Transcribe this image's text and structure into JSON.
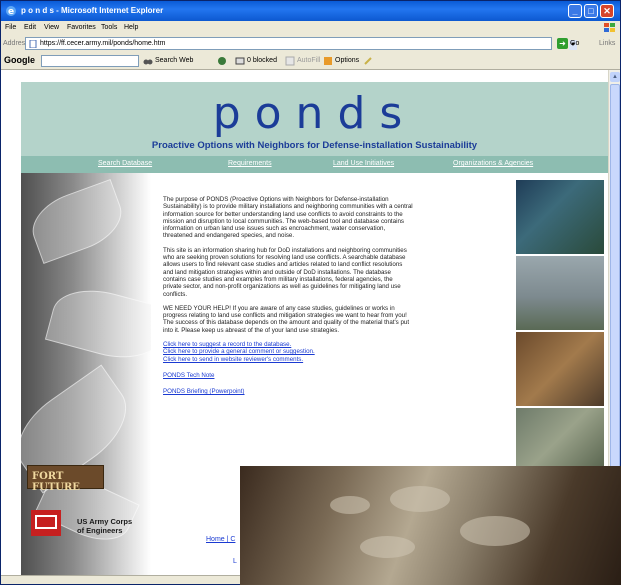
{
  "window": {
    "title": "p o n d s - Microsoft Internet Explorer",
    "controls": {
      "minimize": "_",
      "maximize": "□",
      "close": "✕"
    }
  },
  "menubar": {
    "items": [
      "File",
      "Edit",
      "View",
      "Favorites",
      "Tools",
      "Help"
    ]
  },
  "address_bar": {
    "label": "Address",
    "url": "https://ff.cecer.army.mil/ponds/home.htm",
    "go_label": "Go",
    "links_label": "Links"
  },
  "google_toolbar": {
    "logo": "Google",
    "search_web_label": "Search Web",
    "blocked_label": "0 blocked",
    "autofill_label": "AutoFill",
    "options_label": "Options"
  },
  "page": {
    "logo_word": "ponds",
    "subtitle": "Proactive Options with Neighbors for Defense-installation Sustainability",
    "nav": [
      "Search Database",
      "Requirements",
      "Land Use Initiatives",
      "Organizations & Agencies"
    ],
    "paragraphs": [
      "The purpose of PONDS (Proactive Options with Neighbors for Defense-installation Sustainability) is to provide military installations and neighboring communities with a central information source for better understanding land use conflicts to avoid constraints to the mission and disruption to local communities. The web-based tool and database contains information on urban land use issues such as encroachment, water conservation, threatened and endangered species, and noise.",
      "This site is an information sharing hub for DoD installations and neighboring communities who are seeking proven solutions for resolving land use conflicts. A searchable database allows users to find relevant case studies and articles related to land conflict resolutions and land mitigation strategies within and outside of DoD installations. The database contains case studies and examples from military installations, federal agencies, the private sector, and non-profit organizations as well as guidelines for mitigating land use conflicts.",
      "WE NEED YOUR HELP! If you are aware of any case studies, guidelines or works in progress relating to land use conflicts and mitigation strategies we want to hear from you! The success of this database depends on the amount and quality of the material that's put into it. Please keep us abreast of the of your land use strategies."
    ],
    "links": [
      "Click here to suggest a record to the database.",
      "Click here to provide a general comment or suggestion.",
      "Click here to send in website reviewer's comments."
    ],
    "tech_note": "PONDS Tech Note",
    "briefing": "PONDS Briefing (Powerpoint)",
    "fort_future": "FORT FUTURE",
    "corps_line1": "US Army Corps",
    "corps_line2": "of Engineers",
    "bottom_links": "Home | C",
    "bottom_l": "L"
  }
}
